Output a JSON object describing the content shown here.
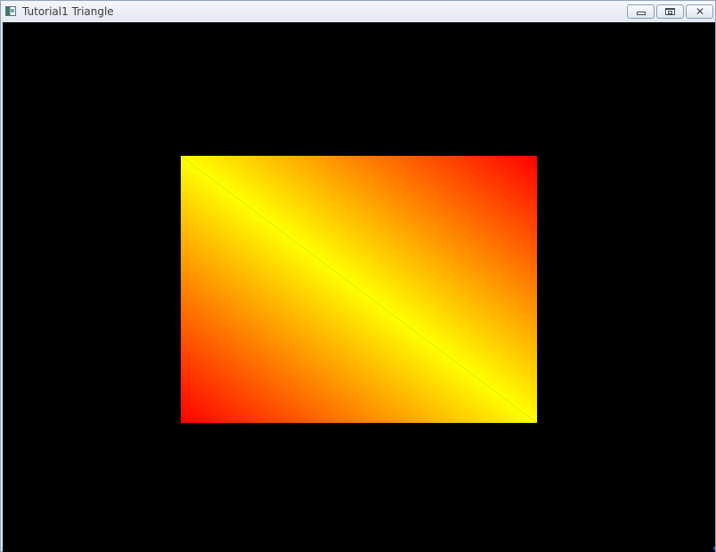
{
  "window": {
    "title": "Tutorial1 Triangle",
    "icon": "app-window-icon",
    "controls": [
      {
        "name": "minimize",
        "icon": "minimize-icon"
      },
      {
        "name": "maximize",
        "icon": "maximize-icon"
      },
      {
        "name": "close",
        "icon": "close-icon",
        "glyph": "✕"
      }
    ]
  },
  "render": {
    "background_color": "#000000",
    "gradient_colors": [
      "#ffff00",
      "#ff0000"
    ]
  }
}
